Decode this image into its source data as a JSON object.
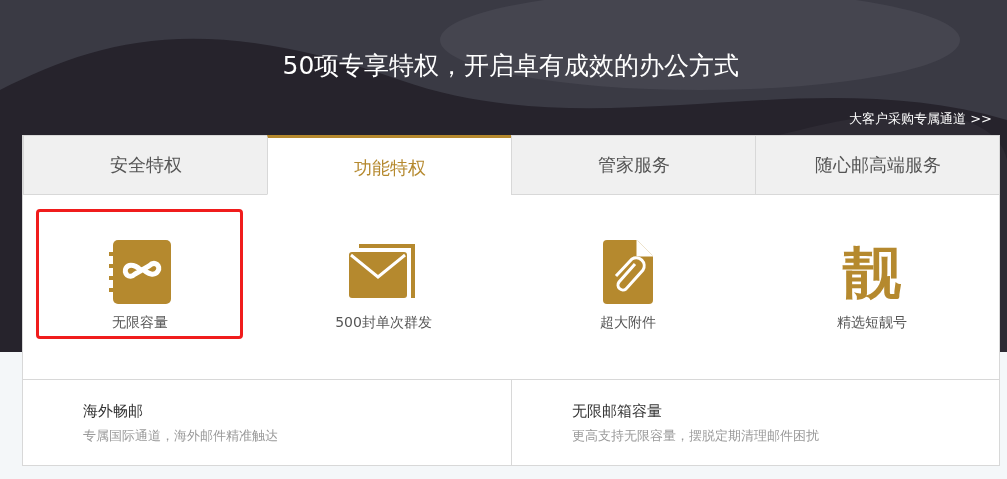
{
  "hero": {
    "kind": "picture",
    "title": "50项专享特权，开启卓有成效的办公方式",
    "link": "大客户采购专属通道 >>"
  },
  "tabs": [
    {
      "label": "安全特权",
      "selected": false
    },
    {
      "label": "功能特权",
      "selected": true
    },
    {
      "label": "管家服务",
      "selected": false
    },
    {
      "label": "随心邮高端服务",
      "selected": false
    }
  ],
  "features": [
    {
      "kind": "infinity",
      "label": "无限容量",
      "highlighted": true
    },
    {
      "kind": "mail",
      "label": "500封单次群发",
      "highlighted": false
    },
    {
      "kind": "attachment",
      "label": "超大附件",
      "highlighted": false
    },
    {
      "kind": "glyph",
      "glyph": "靓",
      "label": "精选短靓号",
      "highlighted": false
    }
  ],
  "cards": [
    {
      "title": "海外畅邮",
      "text": "专属国际通道，海外邮件精准触达"
    },
    {
      "title": "无限邮箱容量",
      "text": "更高支持无限容量，摆脱定期清理邮件困扰"
    }
  ]
}
